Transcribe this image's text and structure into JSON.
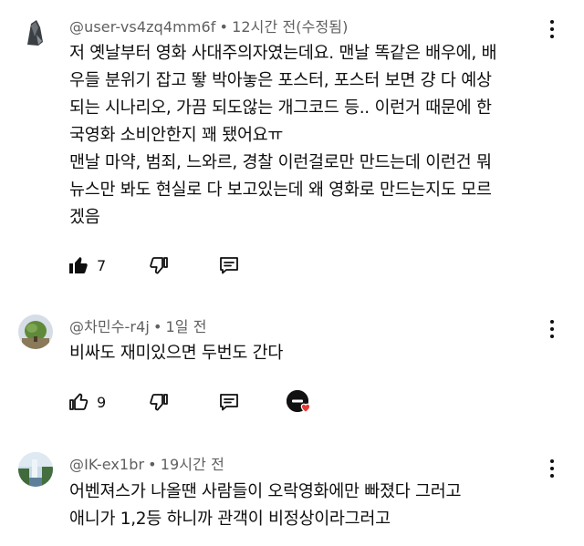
{
  "comments": [
    {
      "author": "@user-vs4zq4mm6f",
      "time": "12시간 전(수정됨)",
      "lines": [
        "저 옛날부터 영화 사대주의자였는데요. 맨날 똑같은 배우에, 배",
        "우들 분위기 잡고 뙇 박아놓은 포스터, 포스터 보면 걍 다 예상",
        "되는 시나리오, 가끔 되도않는 개그코드 등.. 이런거 때문에 한",
        "국영화 소비안한지 꽤 됐어요ㅠ",
        "맨날 마약, 범죄, 느와르, 경찰 이런걸로만 만드는데 이런건 뭐",
        "뉴스만 봐도 현실로 다 보고있는데 왜 영화로 만드는지도 모르",
        "겠음"
      ],
      "like_count": "7",
      "liked": true
    },
    {
      "author": "@차민수-r4j",
      "time": "1일 전",
      "lines": [
        "비싸도 재미있으면 두번도 간다"
      ],
      "like_count": "9",
      "liked": false,
      "creator_heart": true
    },
    {
      "author": "@IK-ex1br",
      "time": "19시간 전",
      "lines": [
        "어벤져스가 나올땐 사람들이 오락영화에만 빠졌다 그러고",
        "애니가 1,2등 하니까 관객이 비정상이라그러고"
      ]
    }
  ],
  "separator": "•",
  "colors": {
    "text": "#0f0f0f",
    "meta": "#606060",
    "heart": "#e53935"
  },
  "icons": {
    "like": "thumbs-up-icon",
    "dislike": "thumbs-down-icon",
    "reply": "reply-icon",
    "more": "more-vertical-icon"
  }
}
